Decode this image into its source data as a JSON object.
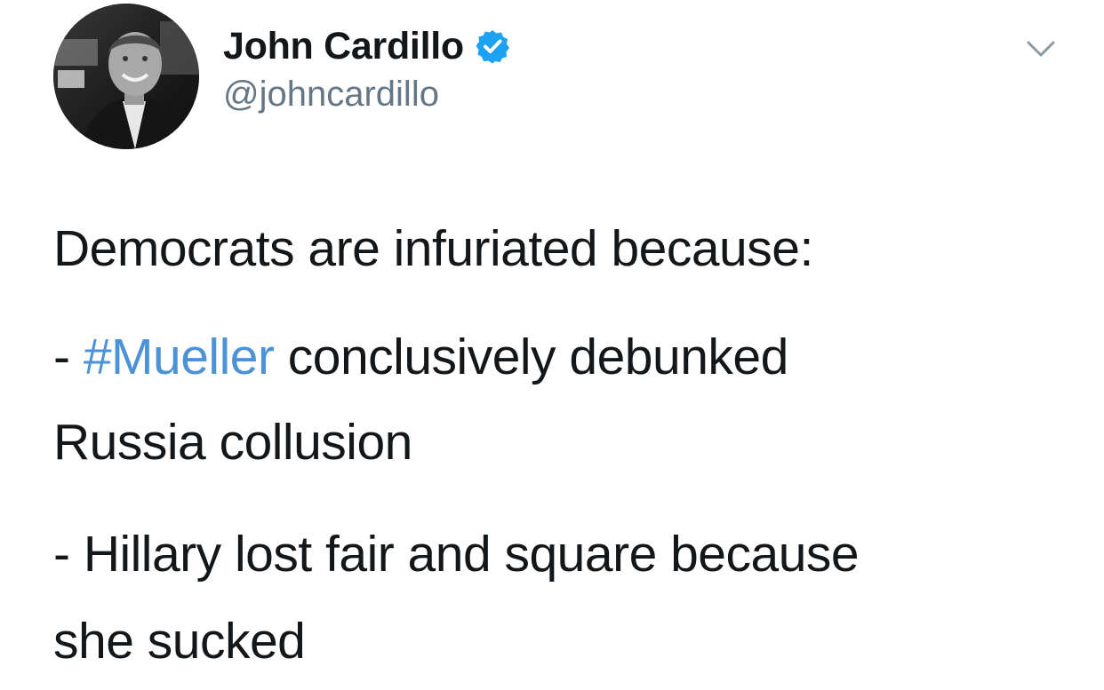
{
  "user": {
    "display_name": "John Cardillo",
    "handle": "@johncardillo",
    "verified_color": "#1da1f2"
  },
  "icons": {
    "verified": "verified-badge-icon",
    "menu": "chevron-down-icon"
  },
  "tweet": {
    "line1": "Democrats are infuriated because:",
    "item1_prefix": "- ",
    "item1_hashtag": "#Mueller",
    "item1_rest": " conclusively debunked",
    "item1_cont": "Russia collusion",
    "item2_line1": "- Hillary lost fair and square because",
    "item2_line2": "she sucked"
  },
  "colors": {
    "text": "#14171a",
    "secondary": "#657786",
    "hashtag": "#4b92d6"
  }
}
